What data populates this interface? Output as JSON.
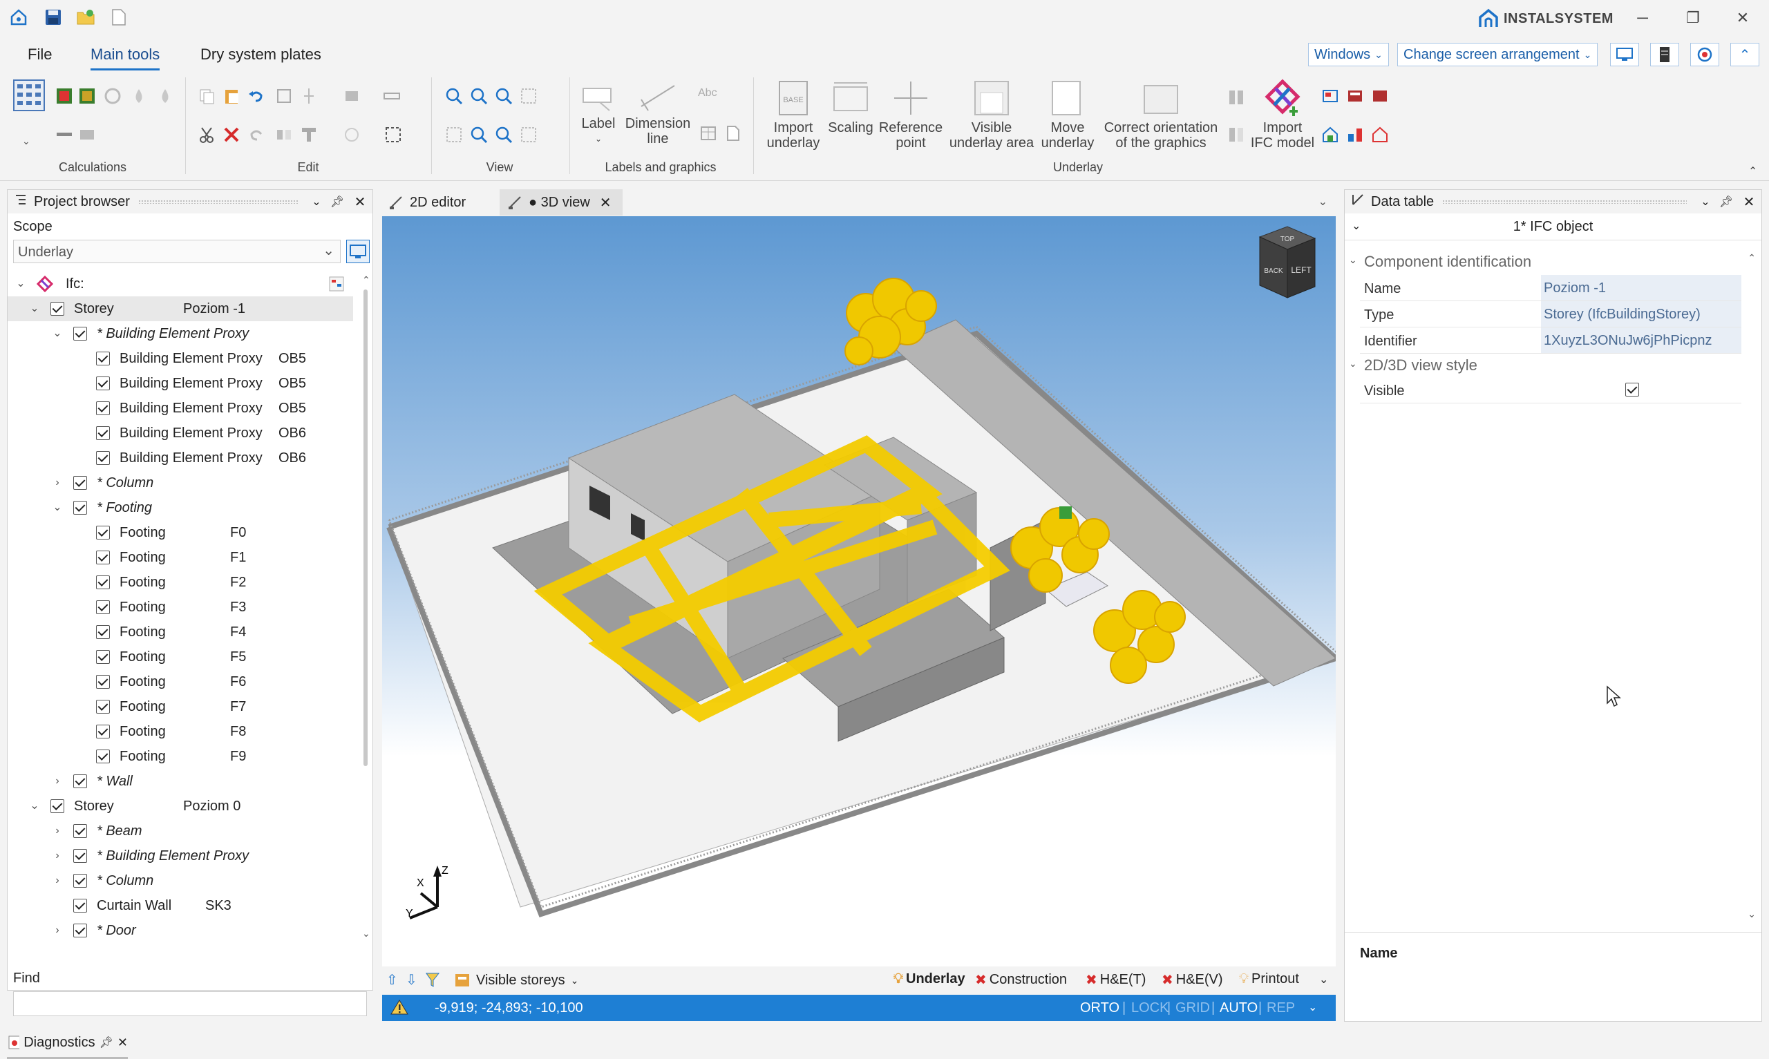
{
  "app": {
    "brand": "INSTALSYSTEM",
    "tabs": [
      "File",
      "Main tools",
      "Dry system plates"
    ],
    "active_tab": "Main tools",
    "windows_label": "Windows",
    "screen_arrangement_label": "Change screen arrangement",
    "accent": "#1e73c8"
  },
  "ribbon": {
    "groups": {
      "calculations": "Calculations",
      "edit": "Edit",
      "view": "View",
      "labels": "Labels and graphics",
      "underlay": "Underlay"
    },
    "buttons": {
      "label": "Label",
      "dimension_line_1": "Dimension",
      "dimension_line_2": "line",
      "text_abc": "Abc",
      "import_underlay_1": "Import",
      "import_underlay_2": "underlay",
      "scaling": "Scaling",
      "reference_point_1": "Reference",
      "reference_point_2": "point",
      "visible_area_1": "Visible",
      "visible_area_2": "underlay area",
      "move_underlay_1": "Move",
      "move_underlay_2": "underlay",
      "correct_orientation_1": "Correct orientation",
      "correct_orientation_2": "of the graphics",
      "import_ifc_1": "Import",
      "import_ifc_2": "IFC model",
      "base_text": "BASE"
    }
  },
  "project_browser": {
    "title": "Project browser",
    "scope_label": "Scope",
    "scope_value": "Underlay",
    "root": "Ifc:",
    "rows": [
      {
        "label": "Storey",
        "code": "Poziom -1",
        "italic": false
      },
      {
        "label": "* Building Element Proxy",
        "code": "",
        "italic": true
      },
      {
        "label": "Building Element Proxy",
        "code": "OB5",
        "italic": false
      },
      {
        "label": "Building Element Proxy",
        "code": "OB5",
        "italic": false
      },
      {
        "label": "Building Element Proxy",
        "code": "OB5",
        "italic": false
      },
      {
        "label": "Building Element Proxy",
        "code": "OB6",
        "italic": false
      },
      {
        "label": "Building Element Proxy",
        "code": "OB6",
        "italic": false
      },
      {
        "label": "* Column",
        "code": "",
        "italic": true
      },
      {
        "label": "* Footing",
        "code": "",
        "italic": true
      },
      {
        "label": "Footing",
        "code": "F0",
        "italic": false
      },
      {
        "label": "Footing",
        "code": "F1",
        "italic": false
      },
      {
        "label": "Footing",
        "code": "F2",
        "italic": false
      },
      {
        "label": "Footing",
        "code": "F3",
        "italic": false
      },
      {
        "label": "Footing",
        "code": "F4",
        "italic": false
      },
      {
        "label": "Footing",
        "code": "F5",
        "italic": false
      },
      {
        "label": "Footing",
        "code": "F6",
        "italic": false
      },
      {
        "label": "Footing",
        "code": "F7",
        "italic": false
      },
      {
        "label": "Footing",
        "code": "F8",
        "italic": false
      },
      {
        "label": "Footing",
        "code": "F9",
        "italic": false
      },
      {
        "label": "* Wall",
        "code": "",
        "italic": true
      },
      {
        "label": "Storey",
        "code": "Poziom 0",
        "italic": false
      },
      {
        "label": "* Beam",
        "code": "",
        "italic": true
      },
      {
        "label": "* Building Element Proxy",
        "code": "",
        "italic": true
      },
      {
        "label": "* Column",
        "code": "",
        "italic": true
      },
      {
        "label": "Curtain Wall",
        "code": "SK3",
        "italic": false
      },
      {
        "label": "* Door",
        "code": "",
        "italic": true
      }
    ],
    "find_label": "Find",
    "find_value": ""
  },
  "editor_tabs": {
    "tab_2d": "2D editor",
    "tab_3d": "● 3D view"
  },
  "view_cube": {
    "top": "TOP",
    "front": "BACK",
    "side": "LEFT"
  },
  "axes": {
    "x": "X",
    "y": "Y",
    "z": "Z"
  },
  "view_bottom": {
    "visible_storeys": "Visible storeys",
    "layers": [
      "Underlay",
      "Construction",
      "H&E(T)",
      "H&E(V)",
      "Printout"
    ]
  },
  "status_bar": {
    "coords": "-9,919; -24,893; -10,100",
    "modes": [
      "ORTO",
      "LOCK",
      "GRID",
      "AUTO",
      "REP"
    ],
    "modes_active": [
      true,
      false,
      false,
      true,
      false
    ],
    "color": "#1e7fd4"
  },
  "data_table": {
    "title": "Data table",
    "header": "1* IFC object",
    "section_component": "Component identification",
    "rows": [
      {
        "name": "Name",
        "value": "Poziom -1"
      },
      {
        "name": "Type",
        "value": "Storey (IfcBuildingStorey)"
      },
      {
        "name": "Identifier",
        "value": "1XuyzL3ONuJw6jPhPicpnz"
      }
    ],
    "section_view": "2D/3D view style",
    "visible_label": "Visible",
    "visible_checked": true,
    "footer_name": "Name"
  },
  "diagnostics": {
    "title": "Diagnostics"
  }
}
